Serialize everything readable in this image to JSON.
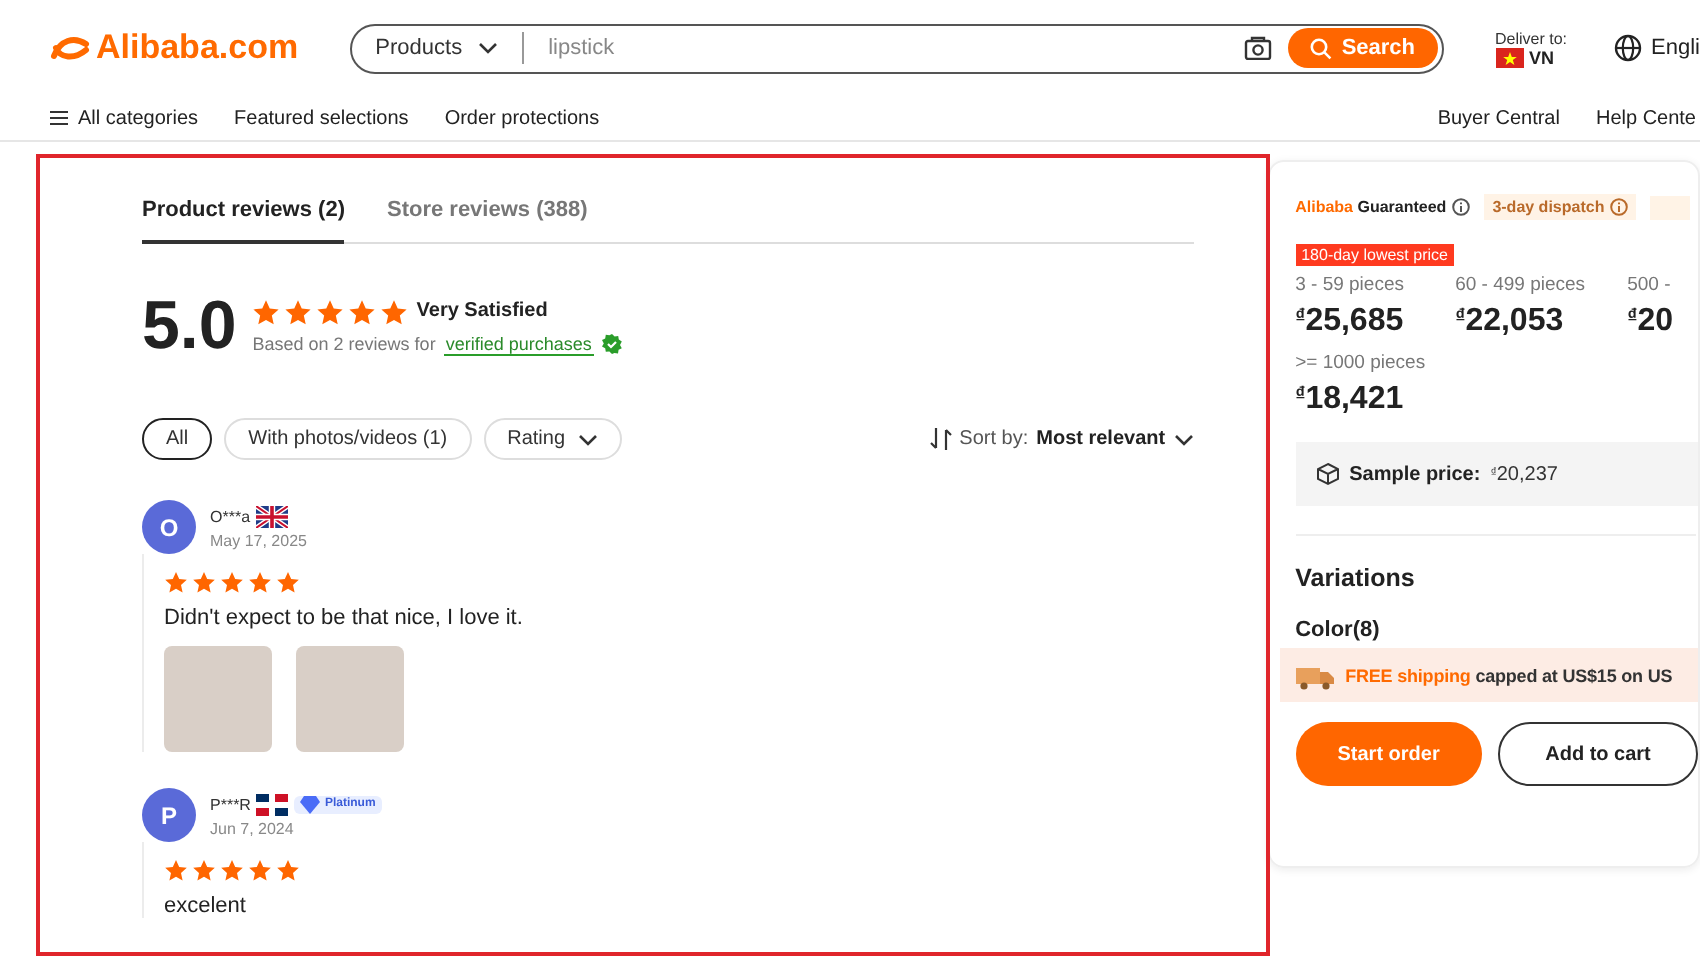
{
  "header": {
    "logo": "Alibaba.com",
    "search": {
      "category": "Products",
      "placeholder": "lipstick",
      "button": "Search"
    },
    "deliver_to": {
      "label": "Deliver to:",
      "country": "VN"
    },
    "language": "Engli"
  },
  "nav": {
    "items": [
      "All categories",
      "Featured selections",
      "Order protections"
    ],
    "right": [
      "Buyer Central",
      "Help Cente"
    ]
  },
  "reviews": {
    "tabs": [
      {
        "label": "Product reviews (2)",
        "selected": true
      },
      {
        "label": "Store reviews (388)",
        "selected": false
      }
    ],
    "score": "5.0",
    "stars": 5,
    "satisfaction": "Very Satisfied",
    "based_on": "Based on 2 reviews for",
    "verified": "verified purchases",
    "filters": [
      {
        "label": "All",
        "selected": true,
        "dropdown": false
      },
      {
        "label": "With photos/videos (1)",
        "selected": false,
        "dropdown": false
      },
      {
        "label": "Rating",
        "selected": false,
        "dropdown": true
      }
    ],
    "sort": {
      "label": "Sort by:",
      "value": "Most relevant"
    },
    "items": [
      {
        "initial": "O",
        "name": "O***a",
        "kind": "british",
        "date": "May 17, 2025",
        "stars": 5,
        "text": "Didn't expect to be that nice, I love it.",
        "photos": [
          {
            "kind": "photo"
          },
          {
            "kind": "photo"
          }
        ]
      },
      {
        "initial": "P",
        "name": "P***R",
        "kind": "dominican",
        "badge": "Platinum",
        "date": "Jun 7, 2024",
        "stars": 5,
        "text": "excelent"
      }
    ]
  },
  "order_card": {
    "guarantee": {
      "brand": "Alibaba",
      "rest": "Guaranteed"
    },
    "dispatch": "3-day dispatch",
    "price_badge": "180-day lowest price",
    "tiers": [
      {
        "range": "3 - 59 pieces",
        "price": "$^{₫}$25,685"
      },
      {
        "range": "60 - 499 pieces",
        "price": "$^{₫}$22,053"
      },
      {
        "range": "500 -",
        "price": "$^{₫}$20"
      },
      {
        "range": ">= 1000 pieces",
        "price": "$^{₫}$18,421"
      }
    ],
    "sample": {
      "label": "Sample price:",
      "value": "$^{₫}$20,237"
    },
    "variations": "Variations",
    "color_label": "Color(8)",
    "shipping": {
      "highlight": "FREE shipping",
      "rest": "capped at US$15 on US"
    },
    "buttons": [
      {
        "label": "Start order",
        "primary": true
      },
      {
        "label": "Add to cart",
        "primary": false
      }
    ]
  }
}
